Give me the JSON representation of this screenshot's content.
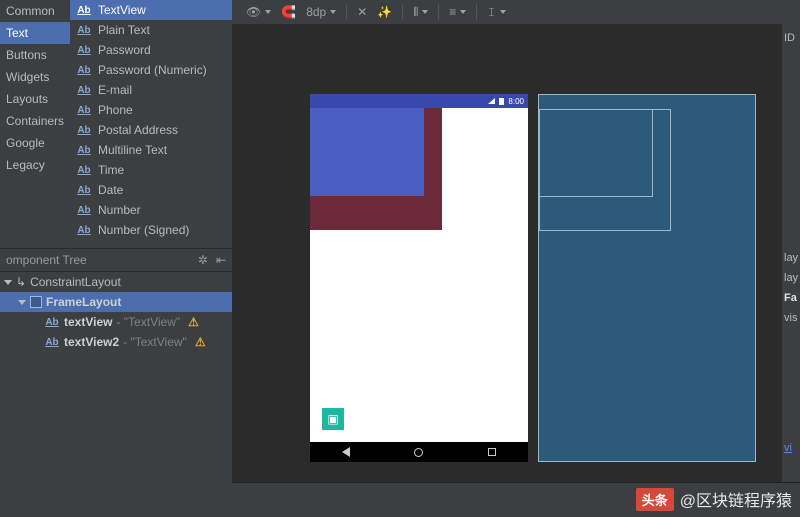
{
  "palette": {
    "categories": [
      "Common",
      "Text",
      "Buttons",
      "Widgets",
      "Layouts",
      "Containers",
      "Google",
      "Legacy"
    ],
    "selected_category_index": 1,
    "items": [
      "TextView",
      "Plain Text",
      "Password",
      "Password (Numeric)",
      "E-mail",
      "Phone",
      "Postal Address",
      "Multiline Text",
      "Time",
      "Date",
      "Number",
      "Number (Signed)"
    ],
    "selected_item_index": 0
  },
  "tree": {
    "title": "omponent Tree",
    "root": "ConstraintLayout",
    "frame": "FrameLayout",
    "children": [
      {
        "name": "textView",
        "text": "TextView"
      },
      {
        "name": "textView2",
        "text": "TextView"
      }
    ]
  },
  "toolbar": {
    "distance": "8dp"
  },
  "device": {
    "time": "8:00"
  },
  "attrs": {
    "id_label": "ID",
    "lay1": "lay",
    "lay2": "lay",
    "fa": "Fa",
    "vis": "vis",
    "view_all": "vi"
  },
  "watermark": {
    "logo": "头条",
    "handle": "@区块链程序猿"
  }
}
